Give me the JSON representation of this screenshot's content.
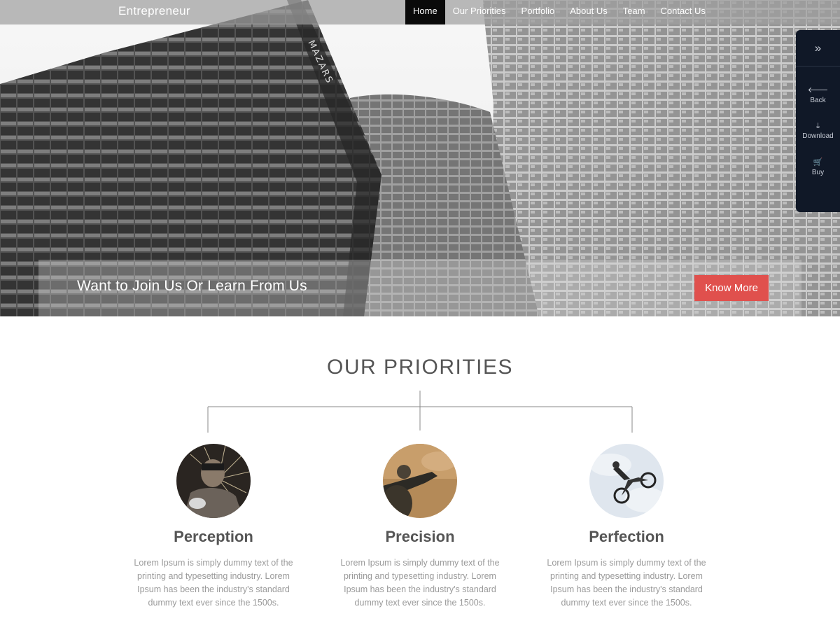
{
  "nav": {
    "brand": "Entrepreneur",
    "items": [
      {
        "label": "Home",
        "active": true
      },
      {
        "label": "Our Priorities",
        "active": false
      },
      {
        "label": "Portfolio",
        "active": false
      },
      {
        "label": "About Us",
        "active": false
      },
      {
        "label": "Team",
        "active": false
      },
      {
        "label": "Contact Us",
        "active": false
      }
    ]
  },
  "side_panel": {
    "toggle_icon": "double-chevron-right-icon",
    "items": [
      {
        "label": "Back",
        "icon": "arrow-left-icon"
      },
      {
        "label": "Download",
        "icon": "download-icon"
      },
      {
        "label": "Buy",
        "icon": "cart-icon"
      }
    ]
  },
  "hero": {
    "banner_text": "Want to Join Us Or Learn From Us",
    "cta_label": "Know More",
    "building_sign": "MAZARS"
  },
  "priorities": {
    "title": "OUR PRIORITIES",
    "cards": [
      {
        "title": "Perception",
        "text": "Lorem Ipsum is simply dummy text of the printing and typesetting industry. Lorem Ipsum has been the industry's standard dummy text ever since the 1500s.",
        "image": "welder-sparks-photo"
      },
      {
        "title": "Precision",
        "text": "Lorem Ipsum is simply dummy text of the printing and typesetting industry. Lorem Ipsum has been the industry's standard dummy text ever since the 1500s.",
        "image": "soldier-rifle-photo"
      },
      {
        "title": "Perfection",
        "text": "Lorem Ipsum is simply dummy text of the printing and typesetting industry. Lorem Ipsum has been the industry's standard dummy text ever since the 1500s.",
        "image": "motocross-jump-photo"
      }
    ]
  },
  "colors": {
    "cta": "#e0504d",
    "side_panel": "#101827",
    "nav_active": "#0a0a0a",
    "title_text": "#555555",
    "body_text": "#9a9a9a"
  }
}
